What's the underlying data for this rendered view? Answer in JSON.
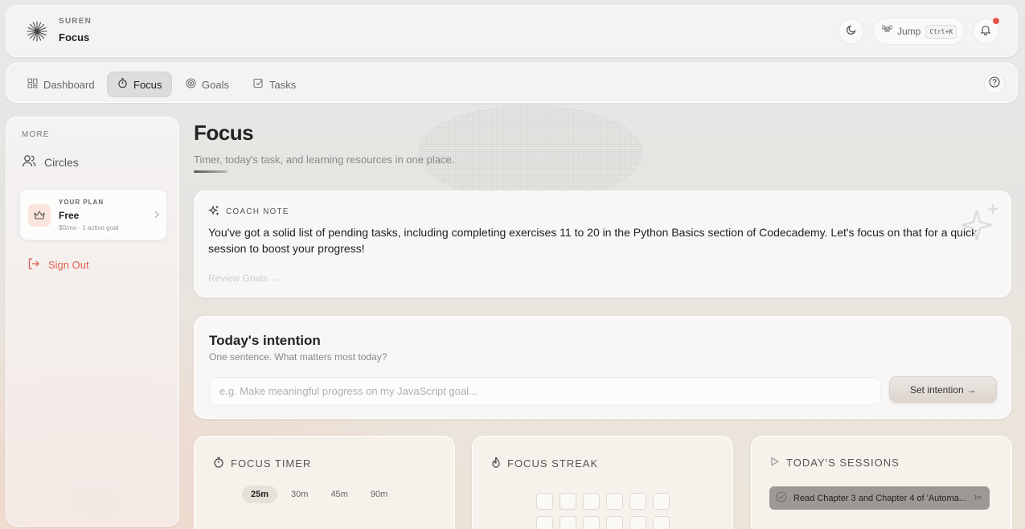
{
  "brand": {
    "small": "SUREN",
    "title": "Focus"
  },
  "header": {
    "jump_label": "Jump",
    "jump_shortcut": "Ctrl+K"
  },
  "nav": {
    "items": [
      {
        "label": "Dashboard",
        "icon": "grid-icon"
      },
      {
        "label": "Focus",
        "icon": "stopwatch-icon",
        "active": true
      },
      {
        "label": "Goals",
        "icon": "target-icon"
      },
      {
        "label": "Tasks",
        "icon": "checkbox-icon"
      }
    ]
  },
  "sidebar": {
    "section": "MORE",
    "circles": "Circles",
    "plan": {
      "label": "YOUR PLAN",
      "name": "Free",
      "sub": "$0/mo · 1 active goal"
    },
    "signout": "Sign Out"
  },
  "page": {
    "title": "Focus",
    "subtitle": "Timer, today's task, and learning resources in one place."
  },
  "coach": {
    "label": "COACH NOTE",
    "text": "You've got a solid list of pending tasks, including completing exercises 11 to 20 in the Python Basics section of Codecademy. Let's focus on that for a quick session to boost your progress!",
    "link": "Review Goals →"
  },
  "intention": {
    "title": "Today's intention",
    "subtitle": "One sentence. What matters most today?",
    "placeholder": "e.g. Make meaningful progress on my JavaScript goal...",
    "button": "Set intention →"
  },
  "timer": {
    "title": "FOCUS TIMER",
    "durations": [
      "25m",
      "30m",
      "45m",
      "90m"
    ],
    "selected": "25m"
  },
  "streak": {
    "title": "FOCUS STREAK"
  },
  "sessions": {
    "title": "TODAY'S SESSIONS",
    "items": [
      {
        "label": "Read Chapter 3 and Chapter 4 of 'Automa...",
        "duration": "1m"
      }
    ]
  },
  "colors": {
    "accent_red": "#e2604f",
    "notif": "#e5544b"
  }
}
